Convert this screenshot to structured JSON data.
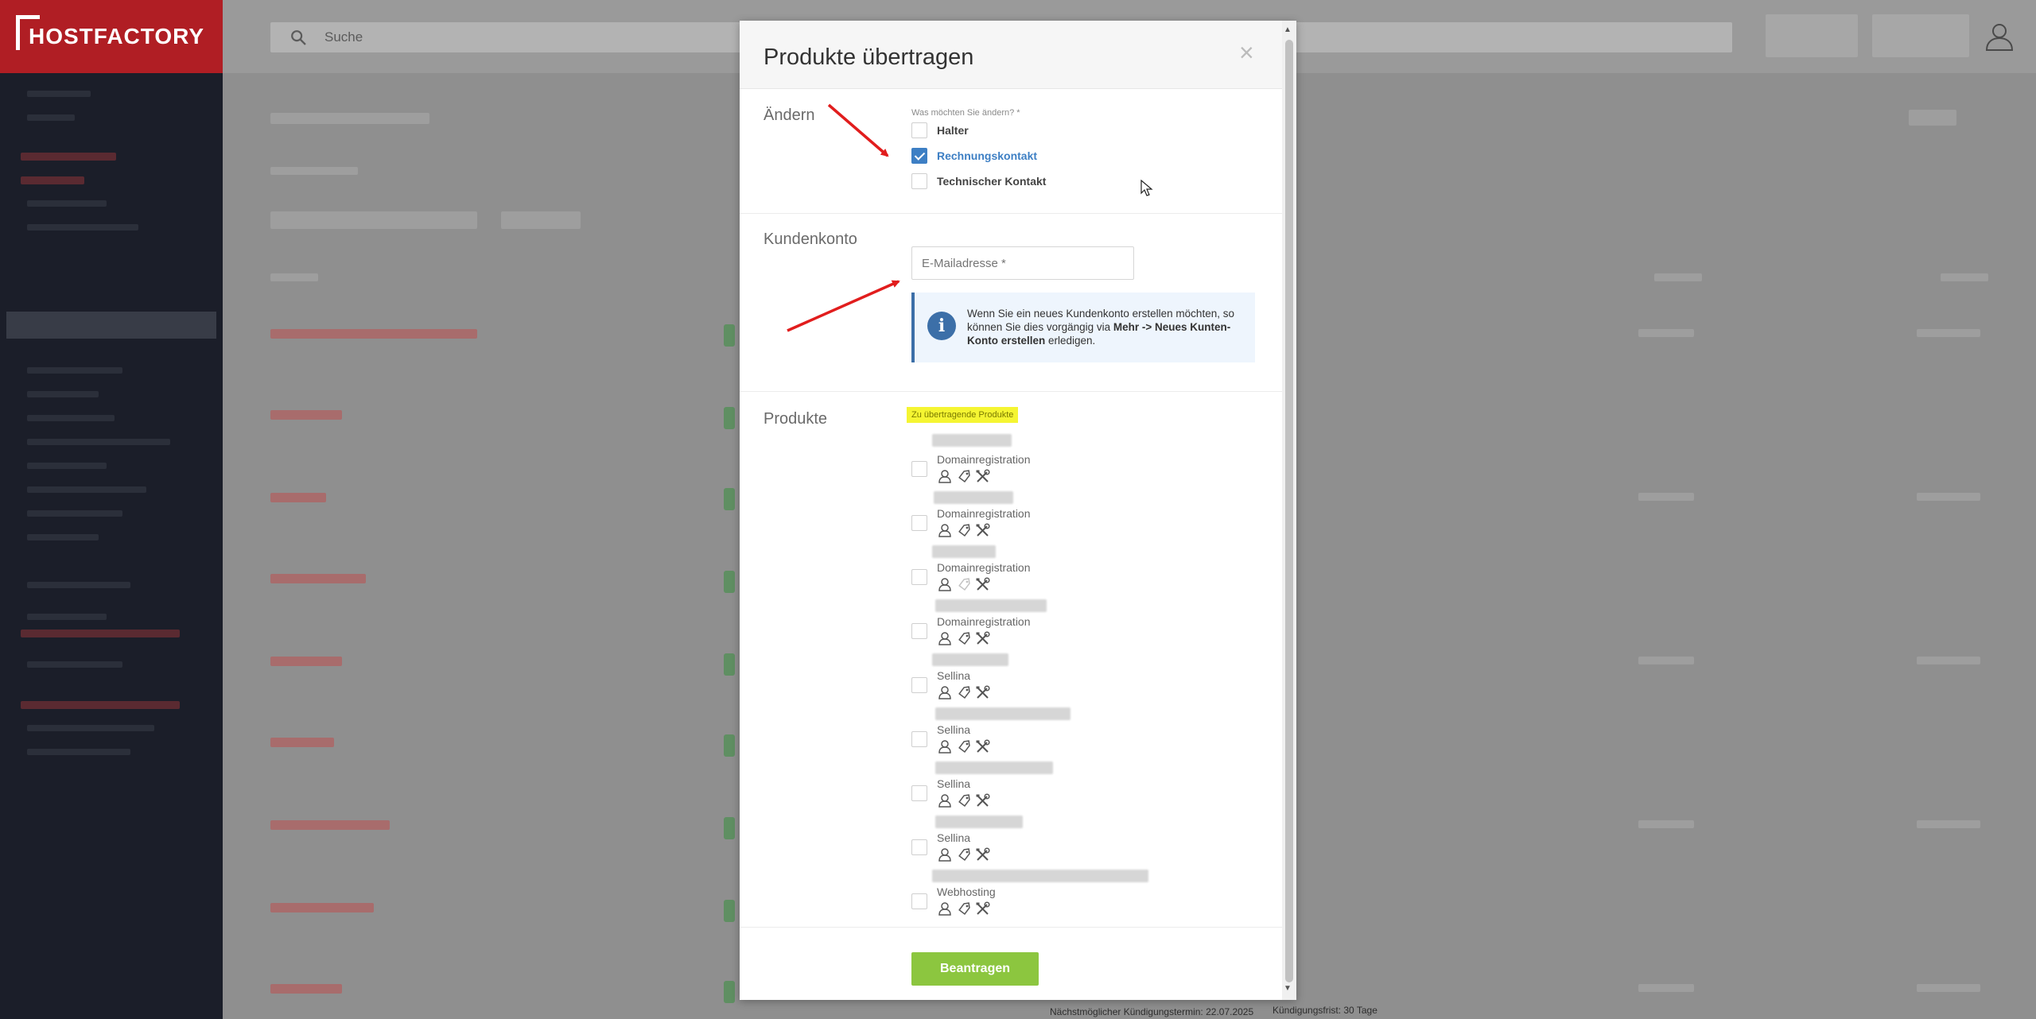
{
  "app": {
    "logo_text": "HOSTFACTORY"
  },
  "search": {
    "placeholder": "Suche"
  },
  "modal": {
    "title": "Produkte übertragen",
    "close_symbol": "×",
    "change_section": {
      "label": "Ändern",
      "question": "Was möchten Sie ändern?",
      "required_mark": "*",
      "options": [
        {
          "label": "Halter",
          "checked": false
        },
        {
          "label": "Rechnungskontakt",
          "checked": true
        },
        {
          "label": "Technischer Kontakt",
          "checked": false
        }
      ]
    },
    "account_section": {
      "label": "Kundenkonto",
      "email_placeholder": "E-Mailadresse *",
      "info": {
        "text_before": "Wenn Sie ein neues Kundenkonto erstellen möchten, so können Sie dies vorgängig via ",
        "bold_text": "Mehr -> Neues Kunten-Konto erstellen",
        "text_after": " erledigen."
      }
    },
    "products_section": {
      "label": "Produkte",
      "list_label": "Zu übertragende Produkte",
      "products": [
        {
          "type": "Domainregistration",
          "checked": false
        },
        {
          "type": "Domainregistration",
          "checked": false
        },
        {
          "type": "Domainregistration",
          "checked": false
        },
        {
          "type": "Domainregistration",
          "checked": false
        },
        {
          "type": "Sellina",
          "checked": false
        },
        {
          "type": "Sellina",
          "checked": false
        },
        {
          "type": "Sellina",
          "checked": false
        },
        {
          "type": "Sellina",
          "checked": false
        },
        {
          "type": "Webhosting",
          "checked": false
        }
      ],
      "icon_names": [
        "user-icon",
        "tag-icon",
        "tools-icon"
      ]
    },
    "submit_label": "Beantragen"
  },
  "background": {
    "notes": [
      "Kündigungsfrist: 30 Tage",
      "Nächstmöglicher Kündigungstermin: 22.07.2025"
    ]
  },
  "colors": {
    "brand_red": "#b01e24",
    "check_blue": "#3d7fc4",
    "submit_green": "#8cc63f",
    "highlight_yellow": "#f5f532",
    "arrow_red": "#e11d1d"
  }
}
